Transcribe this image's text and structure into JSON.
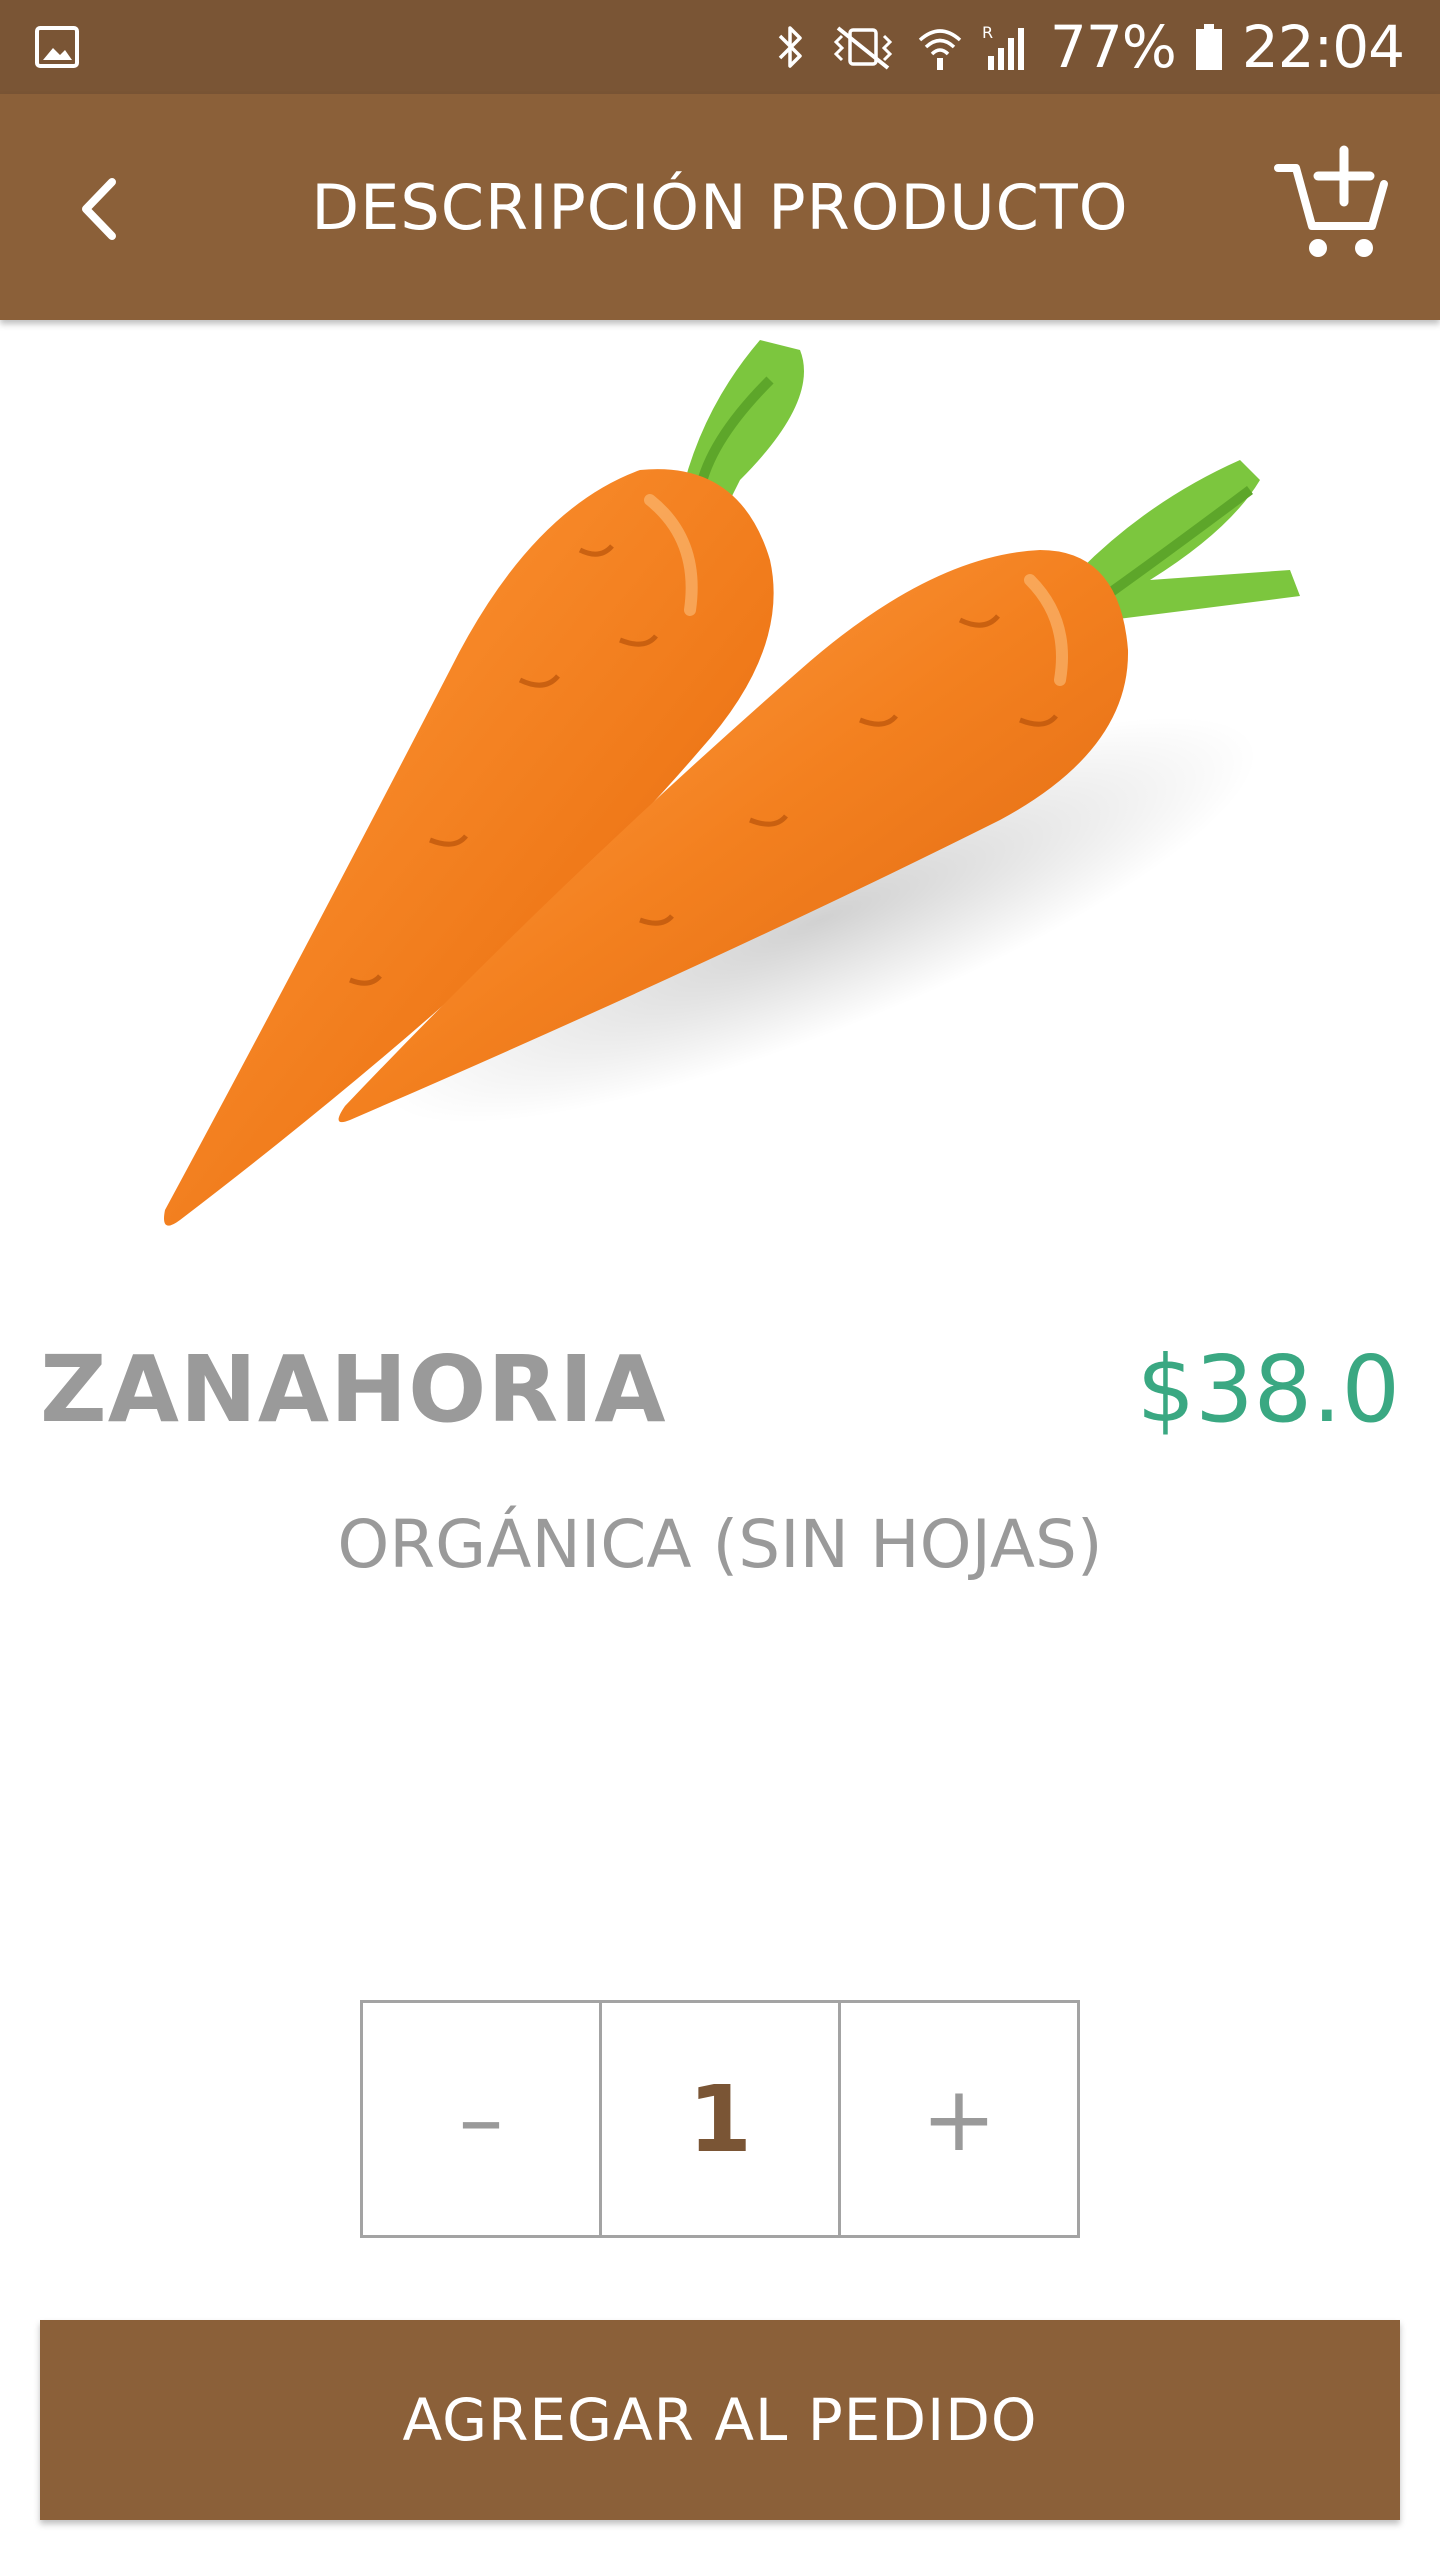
{
  "status_bar": {
    "battery": "77%",
    "time": "22:04",
    "icons": [
      "gallery-icon",
      "bluetooth-icon",
      "vibrate-icon",
      "wifi-icon",
      "signal-icon",
      "battery-icon"
    ]
  },
  "app_bar": {
    "title": "DESCRIPCIÓN PRODUCTO",
    "back_icon": "chevron-left-icon",
    "cart_icon": "add-to-cart-icon"
  },
  "product": {
    "image": "carrots",
    "name": "ZANAHORIA",
    "price": "$38.0",
    "subtitle": "ORGÁNICA (SIN HOJAS)"
  },
  "quantity": {
    "decrement": "–",
    "value": "1",
    "increment": "+"
  },
  "actions": {
    "add_label": "AGREGAR AL PEDIDO"
  },
  "colors": {
    "status_bar": "#7a5535",
    "app_bar": "#8b6039",
    "price": "#3aa882",
    "text_gray": "#9a9a9a"
  }
}
